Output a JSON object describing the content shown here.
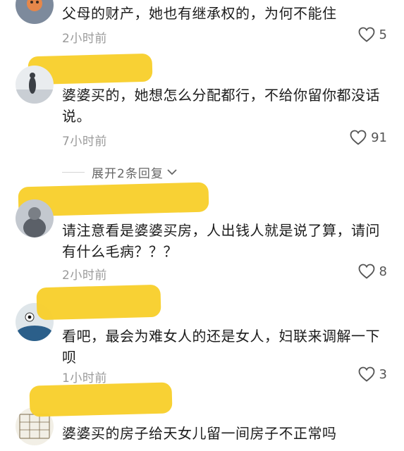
{
  "comments": [
    {
      "text": "父母的财产，她也有继承权的，为何不能住",
      "time": "2小时前",
      "likes": "5"
    },
    {
      "text": "婆婆买的，她想怎么分配都行，不给你留你都没话说。",
      "time": "7小时前",
      "likes": "91"
    },
    {
      "text": "请注意看是婆婆买房，人出钱人就是说了算，请问有什么毛病？？？",
      "time": "2小时前",
      "likes": "8"
    },
    {
      "text": "看吧，最会为难女人的还是女人，妇联来调解一下呗",
      "time": "1小时前",
      "likes": "3"
    },
    {
      "text": "婆婆买的房子给天女儿留一间房子不正常吗",
      "time": "",
      "likes": ""
    }
  ],
  "expand_replies": {
    "label": "展开2条回复"
  },
  "colors": {
    "redaction": "#f8cf2c",
    "timestamp": "#9a9a9a"
  },
  "icons": {
    "like": "heart-outline-icon",
    "expand": "chevron-down-icon"
  }
}
